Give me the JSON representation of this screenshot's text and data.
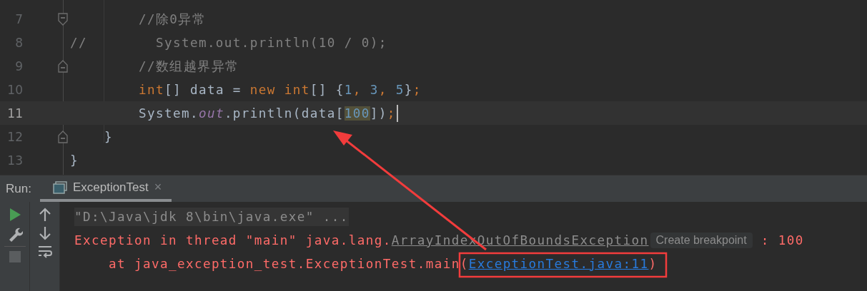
{
  "editor": {
    "lines": [
      {
        "number": "7",
        "current": false,
        "kind": "fold_start",
        "tokens": [
          {
            "text": "        //除0异常",
            "kind": "comment"
          }
        ]
      },
      {
        "number": "8",
        "current": false,
        "kind": "plain",
        "tokens": [
          {
            "text": "//        System.out.println(10 / 0);",
            "kind": "comment"
          }
        ]
      },
      {
        "number": "9",
        "current": false,
        "kind": "fold_end",
        "tokens": [
          {
            "text": "        //数组越界异常",
            "kind": "comment"
          }
        ]
      },
      {
        "number": "10",
        "current": false,
        "kind": "plain",
        "tokens": [
          {
            "text": "        int",
            "kind": "keyword"
          },
          {
            "text": "[] data = ",
            "kind": "plain"
          },
          {
            "text": "new int",
            "kind": "keyword"
          },
          {
            "text": "[] {",
            "kind": "plain"
          },
          {
            "text": "1",
            "kind": "number"
          },
          {
            "text": ", ",
            "kind": "keyword"
          },
          {
            "text": "3",
            "kind": "number"
          },
          {
            "text": ", ",
            "kind": "keyword"
          },
          {
            "text": "5",
            "kind": "number"
          },
          {
            "text": "}",
            "kind": "plain"
          },
          {
            "text": ";",
            "kind": "keyword"
          }
        ]
      },
      {
        "number": "11",
        "current": true,
        "caret": true,
        "kind": "plain",
        "tokens": [
          {
            "text": "        System.",
            "kind": "plain"
          },
          {
            "text": "out",
            "kind": "field"
          },
          {
            "text": ".println(data[",
            "kind": "plain"
          },
          {
            "text": "100",
            "kind": "number",
            "match": true
          },
          {
            "text": "])",
            "kind": "plain"
          },
          {
            "text": ";",
            "kind": "keyword"
          }
        ]
      },
      {
        "number": "12",
        "current": false,
        "kind": "fold_end",
        "tokens": [
          {
            "text": "    }",
            "kind": "plain"
          }
        ]
      },
      {
        "number": "13",
        "current": false,
        "kind": "plain",
        "tokens": [
          {
            "text": "}",
            "kind": "plain"
          }
        ]
      }
    ]
  },
  "run_panel": {
    "label": "Run:",
    "tabs": [
      {
        "label": "ExceptionTest",
        "selected": true,
        "close": "×"
      }
    ],
    "console": [
      {
        "segments": [
          {
            "text": "\"D:\\Java\\jdk 8\\bin\\java.exe\" ...",
            "kind": "command"
          }
        ]
      },
      {
        "segments": [
          {
            "text": "Exception in thread \"main\" java.lang.",
            "kind": "error"
          },
          {
            "text": "ArrayIndexOutOfBoundsException",
            "kind": "class_link"
          },
          {
            "text": "Create breakpoint",
            "kind": "hint"
          },
          {
            "text": " : 100",
            "kind": "error"
          }
        ]
      },
      {
        "segments": [
          {
            "text": "    at java_exception_test.ExceptionTest.main(",
            "kind": "error"
          },
          {
            "text": "ExceptionTest.java:11",
            "kind": "file_link"
          },
          {
            "text": ")",
            "kind": "error"
          }
        ]
      }
    ]
  }
}
